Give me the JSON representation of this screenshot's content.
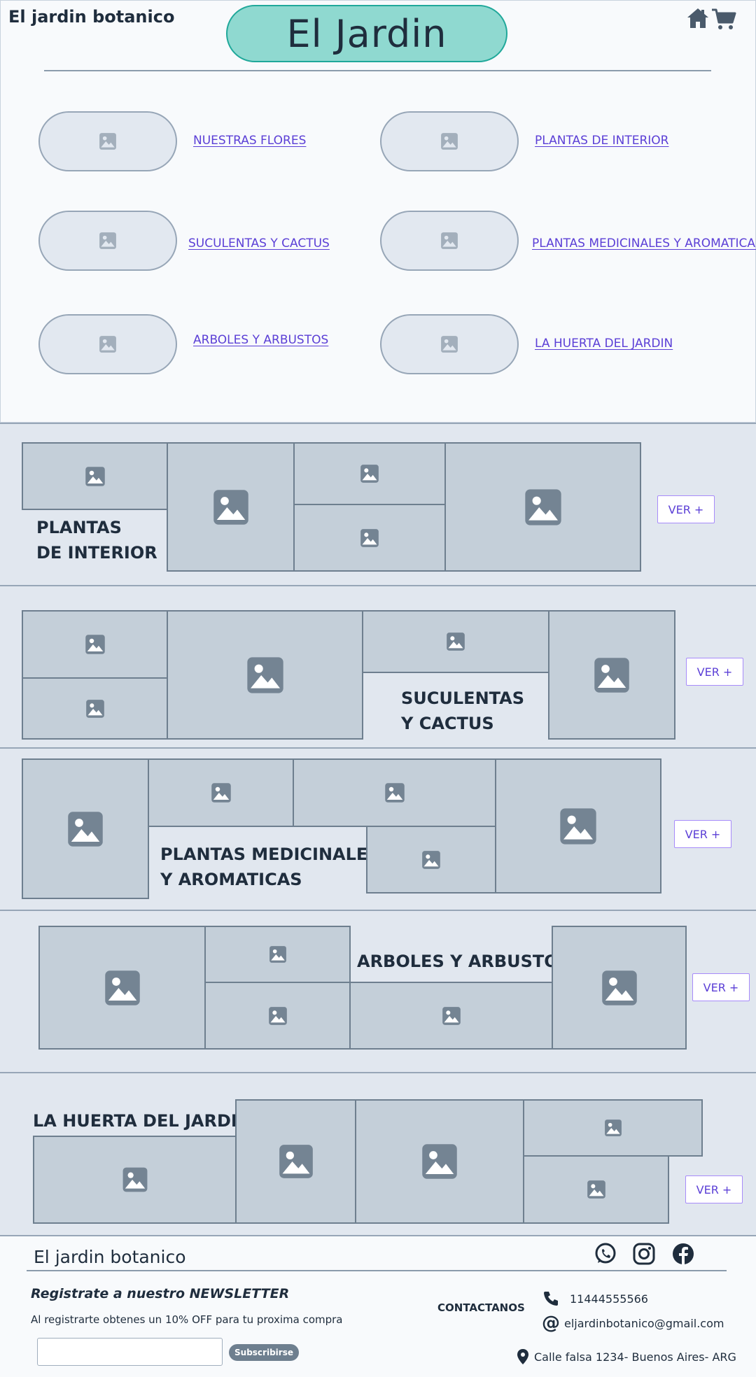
{
  "header": {
    "brand": "El jardin botanico",
    "title": "El Jardin",
    "home_icon": "home-icon",
    "cart_icon": "shopping-cart-icon"
  },
  "categories": [
    {
      "label": "NUESTRAS FLORES"
    },
    {
      "label": "PLANTAS DE INTERIOR"
    },
    {
      "label": "SUCULENTAS Y CACTUS"
    },
    {
      "label": "PLANTAS MEDICINALES  Y AROMATICAS"
    },
    {
      "label": "ARBOLES Y ARBUSTOS"
    },
    {
      "label": "LA HUERTA DEL JARDIN"
    }
  ],
  "sections": [
    {
      "title_line1": "PLANTAS",
      "title_line2": "DE INTERIOR",
      "button": "VER +"
    },
    {
      "title_line1": "SUCULENTAS",
      "title_line2": "Y CACTUS",
      "button": "VER +"
    },
    {
      "title_line1": "PLANTAS MEDICINALES",
      "title_line2": "Y AROMATICAS",
      "button": "VER +"
    },
    {
      "title_line1": "ARBOLES Y ARBUSTOS",
      "button": "VER +"
    },
    {
      "title_line1": "LA HUERTA DEL JARDIN",
      "button": "VER +"
    }
  ],
  "footer": {
    "brand": "El jardin botanico",
    "social_icons": [
      "whatsapp-icon",
      "instagram-icon",
      "facebook-icon"
    ],
    "newsletter_title": "Registrate a nuestro NEWSLETTER",
    "newsletter_text": "Al registrarte obtenes un 10% OFF para tu proxima compra",
    "newsletter_placeholder": "",
    "subscribe_button": "Subscribirse",
    "contact_label": "CONTACTANOS",
    "phone": "11444555566",
    "email": "eljardinbotanico@gmail.com",
    "address": "Calle falsa 1234- Buenos Aires- ARG"
  },
  "colors": {
    "title_pill": "#8fd9d0",
    "link": "#5b3fd6",
    "band": "#e1e7ef",
    "placeholder": "#c4cfd9"
  }
}
